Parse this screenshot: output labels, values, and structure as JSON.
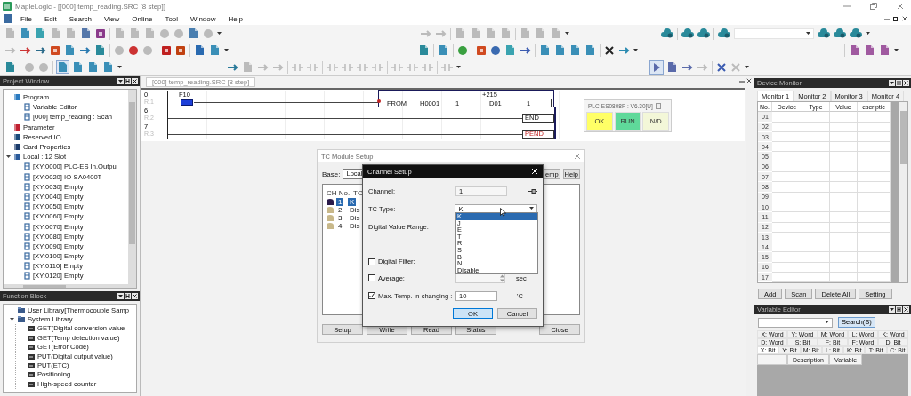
{
  "window": {
    "title": "MapleLogic - [[000] temp_reading.SRC [8 step]]"
  },
  "menu": [
    "File",
    "Edit",
    "Search",
    "View",
    "Online",
    "Tool",
    "Window",
    "Help"
  ],
  "project_window": {
    "title": "Project Window",
    "tree": [
      {
        "label": "Program",
        "children": [
          {
            "label": "Variable Editor"
          },
          {
            "label": "[000] temp_reading : Scan"
          }
        ]
      },
      {
        "label": "Parameter"
      },
      {
        "label": "Reserved IO"
      },
      {
        "label": "Card Properties"
      },
      {
        "label": "Local : 12 Slot",
        "expanded": true,
        "children": [
          {
            "label": "[XY:0000] PLC-ES In.Outpu"
          },
          {
            "label": "[XY:0020] IO-SA0400T"
          },
          {
            "label": "[XY:0030] Empty"
          },
          {
            "label": "[XY:0040] Empty"
          },
          {
            "label": "[XY:0050] Empty"
          },
          {
            "label": "[XY:0060] Empty"
          },
          {
            "label": "[XY:0070] Empty"
          },
          {
            "label": "[XY:0080] Empty"
          },
          {
            "label": "[XY:0090] Empty"
          },
          {
            "label": "[XY:0100] Empty"
          },
          {
            "label": "[XY:0110] Empty"
          },
          {
            "label": "[XY:0120] Empty"
          }
        ]
      }
    ]
  },
  "function_block": {
    "title": "Function Block",
    "tree": [
      {
        "label": "User Library[Thermocouple Samp"
      },
      {
        "label": "System Library",
        "expanded": true,
        "children": [
          {
            "label": "GET(Digital conversion value"
          },
          {
            "label": "GET(Temp detection value)"
          },
          {
            "label": "GET(Error Code)"
          },
          {
            "label": "PUT(Digital output value)"
          },
          {
            "label": "PUT(ETC)"
          },
          {
            "label": "Positioning"
          },
          {
            "label": "High-speed counter"
          }
        ]
      }
    ]
  },
  "editor": {
    "tab": "[000] temp_reading.SRC [8 step]",
    "rungs": [
      {
        "step": "0",
        "row": "R.1",
        "items": [
          {
            "kind": "contact",
            "label": "F10"
          },
          {
            "kind": "function",
            "note": "+215",
            "operands": [
              "FROM",
              "H0001",
              "1",
              "D01",
              "1"
            ]
          }
        ]
      },
      {
        "step": "6",
        "row": "R.2",
        "items": [
          {
            "kind": "end",
            "label": "END"
          }
        ]
      },
      {
        "step": "7",
        "row": "R.3",
        "items": [
          {
            "kind": "pend",
            "label": "PEND"
          }
        ]
      }
    ]
  },
  "plc_status": {
    "model": "PLC-ES0808P : V6.30[U]",
    "indicators": [
      {
        "label": "OK",
        "color": "#ffff66"
      },
      {
        "label": "RUN",
        "color": "#5fd99a"
      },
      {
        "label": "N/D",
        "color": "#f3f7d8"
      }
    ]
  },
  "tc_module_setup": {
    "title": "TC Module Setup",
    "base_label": "Base:",
    "base_value": "Local",
    "buttons": [
      "emp",
      "Help"
    ],
    "columns": [
      "CH No.",
      "TC"
    ],
    "channels": [
      {
        "ch": "1",
        "tc": "K",
        "selected": true
      },
      {
        "ch": "2",
        "tc": "Dis",
        "selected": false
      },
      {
        "ch": "3",
        "tc": "Dis",
        "selected": false
      },
      {
        "ch": "4",
        "tc": "Dis",
        "selected": false
      }
    ],
    "footer_buttons": [
      "Setup",
      "Write",
      "Read",
      "Status"
    ],
    "close_button": "Close"
  },
  "channel_setup": {
    "title": "Channel Setup",
    "channel": {
      "label": "Channel:",
      "value": "1"
    },
    "tc_type": {
      "label": "TC Type:",
      "value": "K",
      "expanded": true,
      "options": [
        {
          "label": "K",
          "selected": true
        },
        {
          "label": "J",
          "selected": false
        },
        {
          "label": "E",
          "selected": false
        },
        {
          "label": "T",
          "selected": false
        },
        {
          "label": "R",
          "selected": false
        },
        {
          "label": "S",
          "selected": false
        },
        {
          "label": "B",
          "selected": false
        },
        {
          "label": "N",
          "selected": false
        },
        {
          "label": "Disable",
          "selected": false
        }
      ]
    },
    "digital_value_range": {
      "label": "Digital Value Range:"
    },
    "digital_filter": {
      "label": "Digital Filter:",
      "checked": false
    },
    "average": {
      "label": "Average:",
      "checked": false,
      "unit": "sec"
    },
    "max_temp": {
      "label": "Max. Temp. in changing :",
      "checked": true,
      "value": "10",
      "unit": "'C"
    },
    "buttons": [
      "OK",
      "Cancel"
    ]
  },
  "device_monitor": {
    "title": "Device Monitor",
    "tabs": [
      {
        "label": "Monitor 1",
        "selected": true
      },
      {
        "label": "Monitor 2",
        "selected": false
      },
      {
        "label": "Monitor 3",
        "selected": false
      },
      {
        "label": "Monitor 4",
        "selected": false
      }
    ],
    "columns": [
      "No.",
      "Device",
      "Type",
      "Value",
      "escriptic"
    ],
    "rows": [
      "01",
      "02",
      "03",
      "04",
      "05",
      "06",
      "07",
      "08",
      "09",
      "10",
      "11",
      "12",
      "13",
      "14",
      "15",
      "16",
      "17"
    ],
    "buttons": [
      "Add",
      "Scan",
      "Delete All",
      "Setting"
    ]
  },
  "variable_editor": {
    "title": "Variable Editor",
    "search_button": "Search(S)",
    "tab_rows": [
      {
        "tabs": [
          {
            "label": "X: Word",
            "selected": false
          },
          {
            "label": "Y: Word",
            "selected": false
          },
          {
            "label": "M: Word",
            "selected": false
          },
          {
            "label": "L: Word",
            "selected": false
          },
          {
            "label": "K: Word",
            "selected": false
          }
        ]
      },
      {
        "tabs": [
          {
            "label": "D: Word",
            "selected": false
          },
          {
            "label": "S: Bit",
            "selected": false
          },
          {
            "label": "F: Bit",
            "selected": false
          },
          {
            "label": "F: Word",
            "selected": false
          },
          {
            "label": "D: Bit",
            "selected": false
          }
        ]
      },
      {
        "tabs": [
          {
            "label": "X: Bit",
            "selected": true
          },
          {
            "label": "Y: Bit",
            "selected": false
          },
          {
            "label": "M: Bit",
            "selected": false
          },
          {
            "label": "L: Bit",
            "selected": false
          },
          {
            "label": "K: Bit",
            "selected": false
          },
          {
            "label": "T: Bit",
            "selected": false
          },
          {
            "label": "C: Bit",
            "selected": false
          }
        ]
      }
    ],
    "columns": [
      "Description",
      "Variable"
    ]
  }
}
